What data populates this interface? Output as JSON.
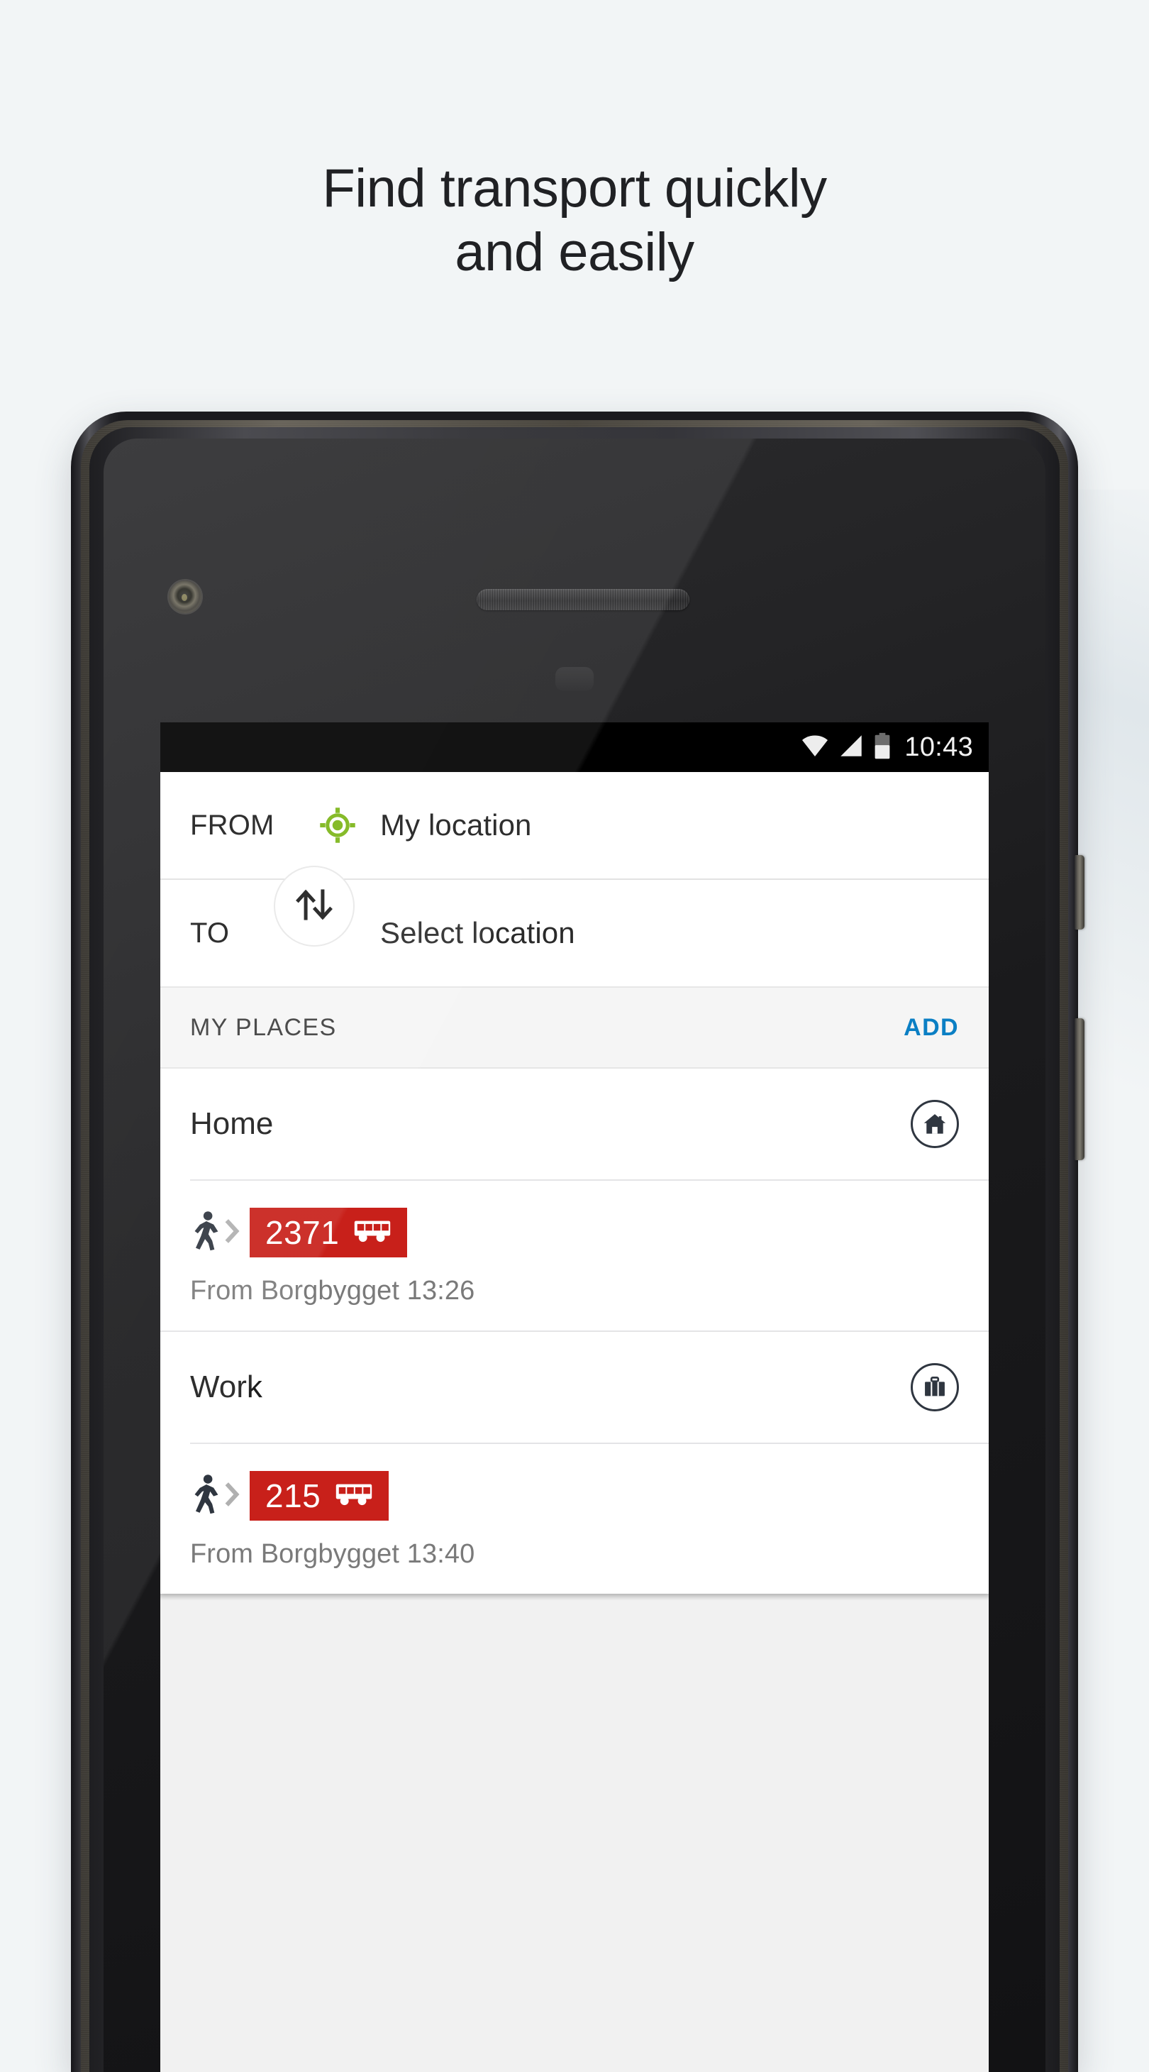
{
  "headline": "Find transport quickly\nand easily",
  "colors": {
    "page_background": "#f2f5f6",
    "accent_blue": "#0b7fc4",
    "line_badge_red": "#c8201a",
    "gps_green": "#7cb518",
    "status_bar": "#000000"
  },
  "device": {
    "status_bar": {
      "time": "10:43",
      "wifi_icon": "wifi-icon",
      "signal_icon": "cellular-signal-icon",
      "battery_icon": "battery-half-icon"
    },
    "front_camera_icon": "front-camera-icon",
    "earpiece_icon": "earpiece-speaker-icon",
    "proximity_sensor_icon": "proximity-sensor-icon",
    "power_button": "power-button",
    "volume_button": "volume-rocker-button"
  },
  "app": {
    "route": {
      "from": {
        "label": "FROM",
        "value": "My location",
        "icon": "gps-crosshair-icon"
      },
      "to": {
        "label": "TO",
        "value": "Select location"
      },
      "swap_icon": "swap-arrows-icon"
    },
    "my_places": {
      "title": "MY PLACES",
      "add_label": "ADD",
      "entries": [
        {
          "name": "Home",
          "icon": "home-icon",
          "departure": {
            "walk_icon": "walking-person-icon",
            "chevron_icon": "chevron-right-icon",
            "line": "2371",
            "mode_icon": "bus-icon",
            "detail": "From Borgbygget 13:26"
          }
        },
        {
          "name": "Work",
          "icon": "briefcase-icon",
          "departure": {
            "walk_icon": "walking-person-icon",
            "chevron_icon": "chevron-right-icon",
            "line": "215",
            "mode_icon": "bus-icon",
            "detail": "From Borgbygget 13:40"
          }
        }
      ]
    }
  }
}
